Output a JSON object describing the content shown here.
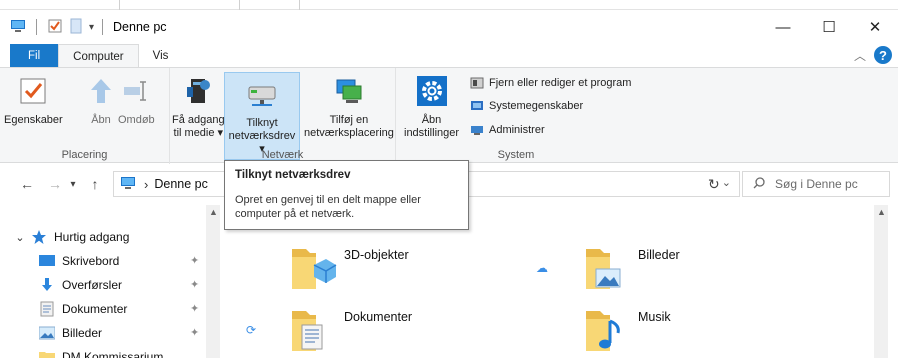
{
  "window": {
    "title": "Denne pc",
    "controls": {
      "minimize": "—",
      "maximize": "☐",
      "close": "✕"
    }
  },
  "ribbon_tabs": [
    {
      "label": "Fil"
    },
    {
      "label": "Computer"
    },
    {
      "label": "Vis"
    }
  ],
  "help_label": "?",
  "ribbon": {
    "groups": [
      {
        "label": "Placering",
        "buttons": [
          {
            "label_line1": "Egenskaber",
            "label_line2": "",
            "icon": "properties-check-icon"
          },
          {
            "label_line1": "Åbn",
            "label_line2": "",
            "icon": "open-arrow-icon"
          },
          {
            "label_line1": "Omdøb",
            "label_line2": "",
            "icon": "rename-icon"
          }
        ]
      },
      {
        "label": "Netværk",
        "buttons": [
          {
            "label_line1": "Få adgang",
            "label_line2": "til medie ▾",
            "icon": "media-server-icon"
          },
          {
            "label_line1": "Tilknyt",
            "label_line2": "netværksdrev ▾",
            "icon": "network-drive-icon"
          },
          {
            "label_line1": "Tilføj en",
            "label_line2": "netværksplacering",
            "icon": "network-location-icon"
          }
        ]
      },
      {
        "label": "System",
        "buttons": [
          {
            "label_line1": "Åbn",
            "label_line2": "indstillinger",
            "icon": "settings-gear-icon"
          }
        ],
        "small_buttons": [
          {
            "label": "Fjern eller rediger et program",
            "icon": "uninstall-program-icon"
          },
          {
            "label": "Systemegenskaber",
            "icon": "system-properties-icon"
          },
          {
            "label": "Administrer",
            "icon": "manage-computer-icon"
          }
        ]
      }
    ]
  },
  "address": {
    "path": "Denne pc",
    "separator": "›",
    "search_placeholder": "Søg i Denne pc"
  },
  "tooltip": {
    "title": "Tilknyt netværksdrev",
    "body": "Opret en genvej til en delt mappe eller computer på et netværk."
  },
  "nav": {
    "items": [
      {
        "label": "Hurtig adgang",
        "icon": "star-icon",
        "pinned": false
      },
      {
        "label": "Skrivebord",
        "icon": "desktop-icon",
        "pinned": true
      },
      {
        "label": "Overførsler",
        "icon": "download-arrow-icon",
        "pinned": true
      },
      {
        "label": "Dokumenter",
        "icon": "documents-icon",
        "pinned": true
      },
      {
        "label": "Billeder",
        "icon": "pictures-icon",
        "pinned": true
      },
      {
        "label": "DM Kommissarium",
        "icon": "folder-icon",
        "pinned": false
      }
    ]
  },
  "folders": [
    {
      "name": "3D-objekter",
      "icon": "folder-3d-objects-icon"
    },
    {
      "name": "Billeder",
      "icon": "folder-pictures-icon"
    },
    {
      "name": "Dokumenter",
      "icon": "folder-documents-icon"
    },
    {
      "name": "Musik",
      "icon": "folder-music-icon"
    }
  ],
  "colors": {
    "accent": "#1979ca",
    "ribbon_bg": "#f5f6f7",
    "selected_bg": "#cce4f7",
    "folder_yellow": "#f8d775"
  }
}
